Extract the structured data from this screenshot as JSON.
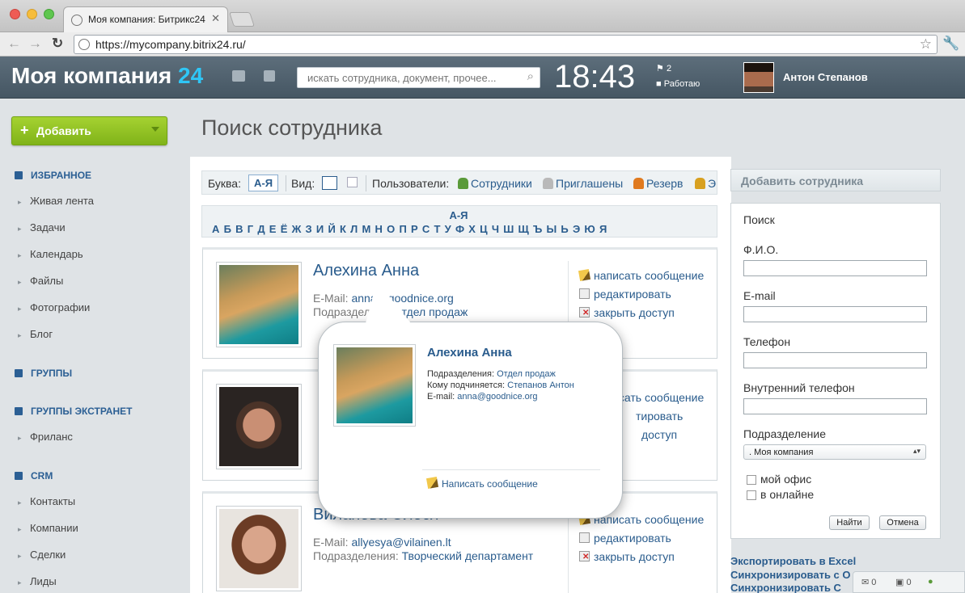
{
  "browser": {
    "tab_title": "Моя компания: Битрикс24",
    "url": "https://mycompany.bitrix24.ru/"
  },
  "header": {
    "logo_text": "Моя компания",
    "logo_num": "24",
    "search_placeholder": "искать сотрудника, документ, прочее...",
    "time": "18:43",
    "tasks_count": "2",
    "work_status": "Работаю",
    "user_name": "Антон Степанов"
  },
  "sidebar": {
    "add_label": "Добавить",
    "sections": {
      "favorites": "ИЗБРАННОЕ",
      "groups": "ГРУППЫ",
      "extranet": "ГРУППЫ ЭКСТРАНЕТ",
      "crm": "CRM"
    },
    "favorites_items": [
      "Живая лента",
      "Задачи",
      "Календарь",
      "Файлы",
      "Фотографии",
      "Блог"
    ],
    "extranet_items": [
      "Фриланс"
    ],
    "crm_items": [
      "Контакты",
      "Компании",
      "Сделки",
      "Лиды"
    ]
  },
  "page": {
    "title": "Поиск сотрудника"
  },
  "filter": {
    "letter_label": "Буква:",
    "letter_value": "А-Я",
    "view_label": "Вид:",
    "users_label": "Пользователи:",
    "links": [
      "Сотрудники",
      "Приглашены",
      "Резерв",
      "Э"
    ]
  },
  "alphabet": {
    "top": "А-Я",
    "letters": "А Б В Г Д Е Ё Ж З И Й К Л М Н О П Р С Т У Ф Х Ц Ч Ш Щ Ъ Ы Ь Э Ю Я"
  },
  "employees": [
    {
      "name": "Алехина Анна",
      "email_label": "E-Mail:",
      "email": "anna@goodnice.org",
      "email_visible": "anna@goodnice.org",
      "dept_label": "Подразделения:",
      "dept": "Отдел продаж"
    },
    {
      "name": "",
      "email_label": "",
      "email": "",
      "dept_label": "",
      "dept": ""
    },
    {
      "name": "Виланова Олеся",
      "email_label": "E-Mail:",
      "email": "allyesya@vilainen.lt",
      "dept_label": "Подразделения:",
      "dept": "Творческий департамент"
    }
  ],
  "card_visible_text": {
    "c1_email_fragment": "anna@goodnice.org",
    "c1_dept_fragment": "тдел продаж"
  },
  "actions": {
    "write": "написать сообщение",
    "edit": "редактировать",
    "close_access": "закрыть доступ",
    "edit_partial": "тировать",
    "close_partial": "доступ"
  },
  "popup": {
    "name": "Алехина Анна",
    "dept_label": "Подразделения:",
    "dept": "Отдел продаж",
    "manager_label": "Кому подчиняется:",
    "manager": "Степанов Антон",
    "email_label": "E-mail:",
    "email": "anna@goodnice.org",
    "write_label": "Написать сообщение"
  },
  "right_panel": {
    "add_employee": "Добавить сотрудника",
    "search_title": "Поиск",
    "fields": [
      "Ф.И.О.",
      "E-mail",
      "Телефон",
      "Внутренний телефон"
    ],
    "dept_label": "Подразделение",
    "dept_value": ". Моя компания",
    "checkbox_office": "мой офис",
    "checkbox_online": "в онлайне",
    "find_button": "Найти",
    "cancel_button": "Отмена",
    "export_link": "Экспортировать в Excel",
    "sync_link1": "Синхронизировать с О",
    "sync_link2": "Синхронизировать С"
  },
  "notifications": {
    "mail_count": "0",
    "chat_count": "0"
  },
  "colors": {
    "accent": "#2a5c8d",
    "add_button": "#8dbf1f",
    "logo_num": "#2fc6f6"
  }
}
